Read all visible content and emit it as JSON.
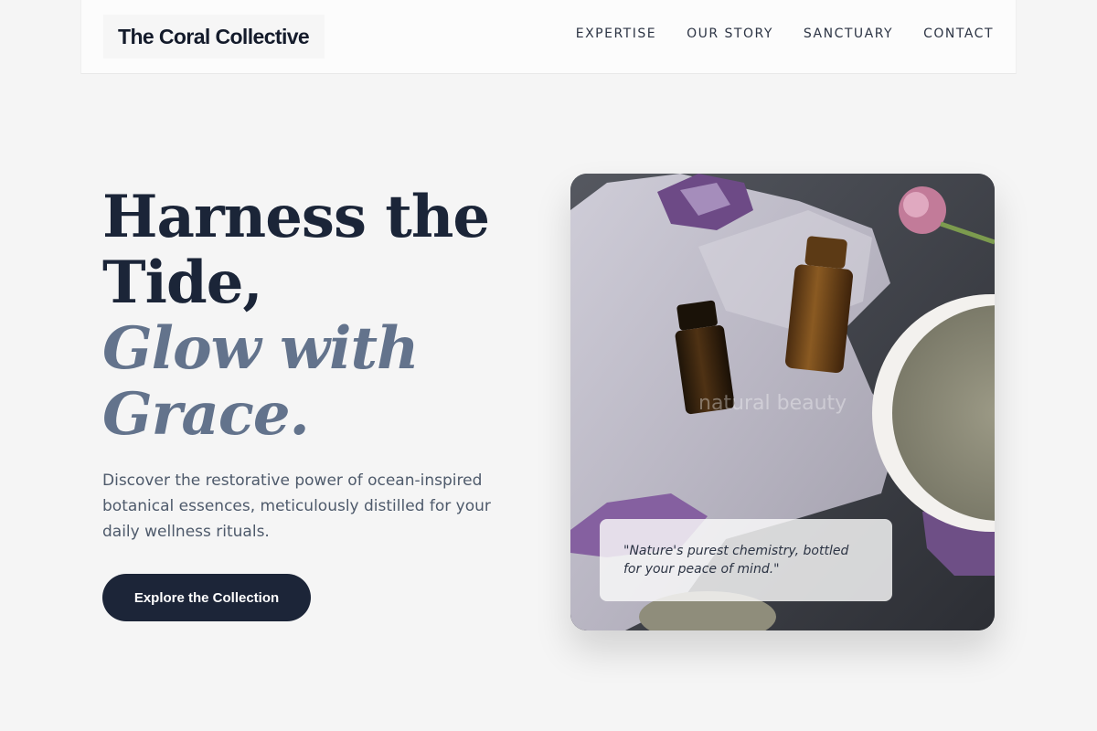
{
  "header": {
    "logo": "The Coral Collective",
    "nav": [
      "EXPERTISE",
      "OUR STORY",
      "SANCTUARY",
      "CONTACT"
    ]
  },
  "hero": {
    "title_line1": "Harness the",
    "title_line2": "Tide,",
    "title_line3": "Glow with",
    "title_line4": "Grace.",
    "description": "Discover the restorative power of ocean-inspired botanical essences, meticulously distilled for your daily wellness rituals.",
    "cta_label": "Explore the Collection"
  },
  "image_card": {
    "watermark": "natural beauty",
    "quote": "\"Nature's purest chemistry, bottled for your peace of mind.\""
  },
  "colors": {
    "background": "#f5f5f5",
    "navy": "#1c2538",
    "slate_italic": "#63738c",
    "body_text": "#4e5a6b"
  }
}
